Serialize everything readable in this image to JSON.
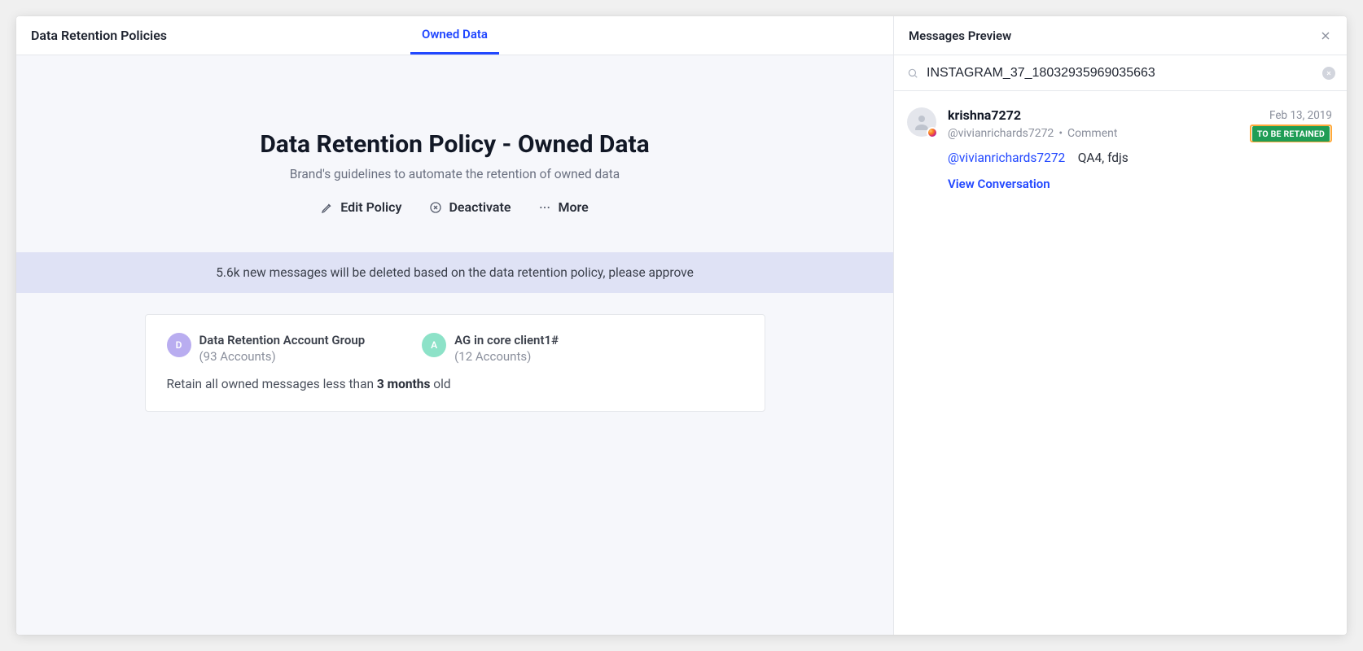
{
  "topbar": {
    "title": "Data Retention Policies",
    "active_tab": "Owned Data"
  },
  "hero": {
    "title": "Data Retention Policy - Owned Data",
    "subtitle": "Brand's guidelines to automate the retention of owned data"
  },
  "actions": {
    "edit": "Edit Policy",
    "deactivate": "Deactivate",
    "more": "More"
  },
  "notice": "5.6k new messages will be deleted based on the data retention policy, please approve",
  "groups": [
    {
      "initial": "D",
      "name": "Data Retention Account Group",
      "count": "(93 Accounts)",
      "color": "purple"
    },
    {
      "initial": "A",
      "name": "AG in core client1#",
      "count": "(12 Accounts)",
      "color": "teal"
    }
  ],
  "retain_line": {
    "prefix": "Retain all owned messages less than ",
    "bold": "3 months",
    "suffix": " old"
  },
  "panel": {
    "title": "Messages Preview",
    "search_value": "INSTAGRAM_37_18032935969035663"
  },
  "message": {
    "author": "krishna7272",
    "handle": "@vivianrichards7272",
    "type": "Comment",
    "date": "Feb 13, 2019",
    "badge": "TO BE RETAINED",
    "mention": "@vivianrichards7272",
    "text": "QA4, fdjs",
    "link": "View Conversation"
  }
}
